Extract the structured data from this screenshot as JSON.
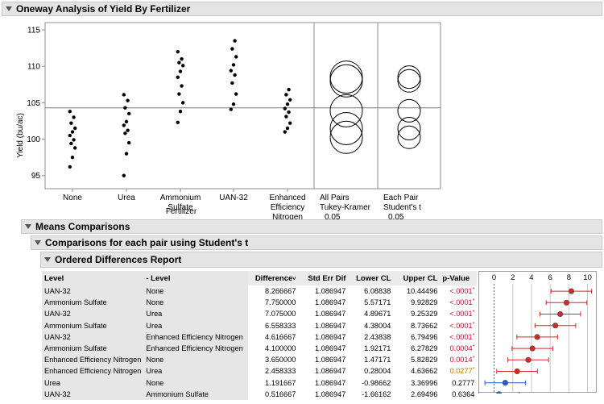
{
  "report": {
    "title": "Oneway Analysis of Yield By Fertilizer"
  },
  "plot": {
    "y_axis_label": "Yield (bu/ac)",
    "y_ticks": [
      "115",
      "110",
      "105",
      "100",
      "95"
    ],
    "x_axis_label": "Fertilizer",
    "grand_mean": 104.3,
    "categories": [
      {
        "label_lines": [
          "None"
        ],
        "values": [
          96.2,
          97.5,
          98.8,
          99.4,
          99.9,
          100.5,
          101.0,
          101.5,
          102.2,
          103.0,
          103.8
        ]
      },
      {
        "label_lines": [
          "Urea"
        ],
        "values": [
          95.0,
          98.0,
          99.5,
          100.8,
          101.2,
          101.9,
          102.4,
          103.5,
          104.3,
          105.3,
          106.1
        ]
      },
      {
        "label_lines": [
          "Ammonium",
          "Sulfate"
        ],
        "values": [
          102.3,
          103.8,
          105.0,
          106.2,
          107.3,
          108.5,
          109.3,
          110.1,
          110.5,
          111.0,
          112.0
        ]
      },
      {
        "label_lines": [
          "UAN-32"
        ],
        "values": [
          104.1,
          104.8,
          106.2,
          107.7,
          108.8,
          109.4,
          110.2,
          111.3,
          112.4,
          113.5
        ]
      },
      {
        "label_lines": [
          "Enhanced",
          "Efficiency",
          "Nitrogen"
        ],
        "values": [
          101.0,
          101.5,
          102.2,
          103.1,
          103.7,
          104.2,
          104.8,
          105.4,
          106.1,
          106.8
        ]
      }
    ],
    "comparison_panels": [
      {
        "label_lines": [
          "All Pairs",
          "Tukey-Kramer",
          "0.05"
        ]
      },
      {
        "label_lines": [
          "Each Pair",
          "Student's t",
          "0.05"
        ]
      }
    ]
  },
  "means_comparisons": {
    "title": "Means Comparisons",
    "subtitle": "Comparisons for each pair using Student's t",
    "report_title": "Ordered Differences Report",
    "columns": [
      "Level",
      "- Level",
      "Difference",
      "Std Err Dif",
      "Lower CL",
      "Upper CL",
      "p-Value"
    ],
    "rows": [
      {
        "level": "UAN-32",
        "minus_level": "None",
        "difference": "8.266667",
        "std_err": "1.086947",
        "lower_cl": "6.08838",
        "upper_cl": "10.44496",
        "p_value": "<.0001",
        "sig": "red"
      },
      {
        "level": "Ammonium Sulfate",
        "minus_level": "None",
        "difference": "7.750000",
        "std_err": "1.086947",
        "lower_cl": "5.57171",
        "upper_cl": "9.92829",
        "p_value": "<.0001",
        "sig": "red"
      },
      {
        "level": "UAN-32",
        "minus_level": "Urea",
        "difference": "7.075000",
        "std_err": "1.086947",
        "lower_cl": "4.89671",
        "upper_cl": "9.25329",
        "p_value": "<.0001",
        "sig": "red"
      },
      {
        "level": "Ammonium Sulfate",
        "minus_level": "Urea",
        "difference": "6.558333",
        "std_err": "1.086947",
        "lower_cl": "4.38004",
        "upper_cl": "8.73662",
        "p_value": "<.0001",
        "sig": "red"
      },
      {
        "level": "UAN-32",
        "minus_level": "Enhanced Efficiency Nitrogen",
        "difference": "4.616667",
        "std_err": "1.086947",
        "lower_cl": "2.43838",
        "upper_cl": "6.79496",
        "p_value": "<.0001",
        "sig": "red"
      },
      {
        "level": "Ammonium Sulfate",
        "minus_level": "Enhanced Efficiency Nitrogen",
        "difference": "4.100000",
        "std_err": "1.086947",
        "lower_cl": "1.92171",
        "upper_cl": "6.27829",
        "p_value": "0.0004",
        "sig": "red"
      },
      {
        "level": "Enhanced Efficiency Nitrogen",
        "minus_level": "None",
        "difference": "3.650000",
        "std_err": "1.086947",
        "lower_cl": "1.47171",
        "upper_cl": "5.82829",
        "p_value": "0.0014",
        "sig": "red"
      },
      {
        "level": "Enhanced Efficiency Nitrogen",
        "minus_level": "Urea",
        "difference": "2.458333",
        "std_err": "1.086947",
        "lower_cl": "0.28004",
        "upper_cl": "4.63662",
        "p_value": "0.0277",
        "sig": "orange"
      },
      {
        "level": "Urea",
        "minus_level": "None",
        "difference": "1.191667",
        "std_err": "1.086947",
        "lower_cl": "-0.98662",
        "upper_cl": "3.36996",
        "p_value": "0.2777",
        "sig": "none"
      },
      {
        "level": "UAN-32",
        "minus_level": "Ammonium Sulfate",
        "difference": "0.516667",
        "std_err": "1.086947",
        "lower_cl": "-1.66162",
        "upper_cl": "2.69496",
        "p_value": "0.6364",
        "sig": "none"
      }
    ],
    "forest": {
      "ticks": [
        "0",
        "2",
        "4",
        "6",
        "8",
        "10"
      ],
      "xlim": [
        -1.6,
        10.9
      ]
    }
  },
  "colors": {
    "significant": "#d62728",
    "significant_marginal": "#c07a00",
    "not_significant": "#1f5fd6"
  }
}
